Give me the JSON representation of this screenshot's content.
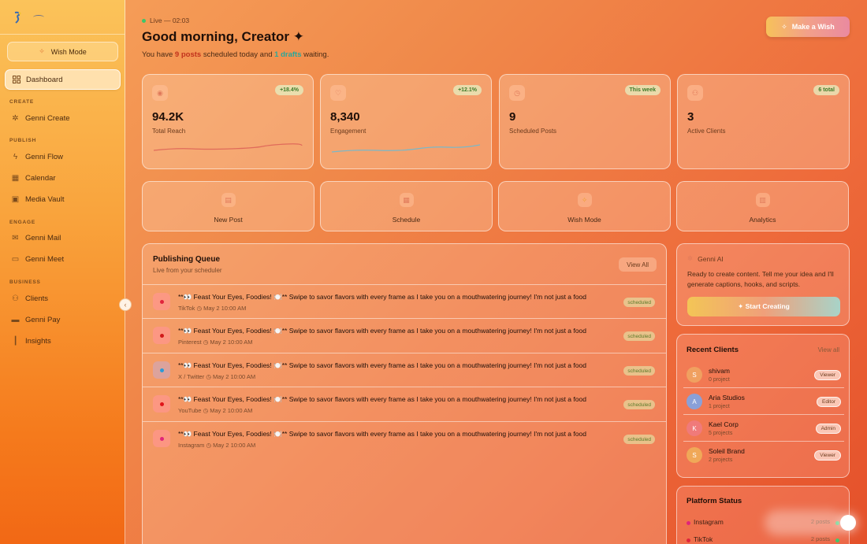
{
  "sidebar": {
    "wish_mode": "Wish Mode",
    "items": [
      {
        "label": "Dashboard",
        "icon": "grid-icon"
      },
      {
        "label": "Genni Create",
        "icon": "sparkles-icon"
      },
      {
        "label": "Genni Flow",
        "icon": "bolt-icon"
      },
      {
        "label": "Calendar",
        "icon": "calendar-icon"
      },
      {
        "label": "Media Vault",
        "icon": "image-icon"
      },
      {
        "label": "Genni Mail",
        "icon": "mail-icon"
      },
      {
        "label": "Genni Meet",
        "icon": "video-icon"
      },
      {
        "label": "Clients",
        "icon": "users-icon"
      },
      {
        "label": "Genni Pay",
        "icon": "card-icon"
      },
      {
        "label": "Insights",
        "icon": "bar-chart-icon"
      }
    ],
    "sections": [
      "CREATE",
      "PUBLISH",
      "ENGAGE",
      "BUSINESS"
    ]
  },
  "header": {
    "live": "Live — 02:03",
    "greeting": "Good morning, Creator",
    "sparkle": "✦",
    "sub_pre": "You have ",
    "sub_posts": "9 posts",
    "sub_mid": " scheduled today and ",
    "sub_drafts": "1 drafts",
    "sub_post": " waiting.",
    "make_wish": "Make a Wish"
  },
  "stats": [
    {
      "value": "94.2K",
      "label": "Total Reach",
      "badge": "+18.4%",
      "icon": "eye-icon"
    },
    {
      "value": "8,340",
      "label": "Engagement",
      "badge": "+12.1%",
      "icon": "heart-icon"
    },
    {
      "value": "9",
      "label": "Scheduled Posts",
      "badge": "This week",
      "icon": "clock-icon"
    },
    {
      "value": "3",
      "label": "Active Clients",
      "badge": "6 total",
      "icon": "users-icon"
    }
  ],
  "quick_actions": [
    {
      "label": "New Post",
      "icon": "file-icon"
    },
    {
      "label": "Schedule",
      "icon": "calendar-icon"
    },
    {
      "label": "Wish Mode",
      "icon": "wand-icon"
    },
    {
      "label": "Analytics",
      "icon": "chart-icon"
    }
  ],
  "queue": {
    "title": "Publishing Queue",
    "subtitle": "Live from your scheduler",
    "view_all": "View All",
    "rows": [
      {
        "text": "**👀 Feast Your Eyes, Foodies! 🍽️** Swipe to savor flavors with every frame as I take you on a mouthwatering journey! I'm not just a food",
        "platform": "TikTok",
        "time": "May 2 10:00 AM",
        "status": "scheduled",
        "dot": "#e0243c"
      },
      {
        "text": "**👀 Feast Your Eyes, Foodies! 🍽️** Swipe to savor flavors with every frame as I take you on a mouthwatering journey! I'm not just a food",
        "platform": "Pinterest",
        "time": "May 2 10:00 AM",
        "status": "scheduled",
        "dot": "#d01a1a"
      },
      {
        "text": "**👀 Feast Your Eyes, Foodies! 🍽️** Swipe to savor flavors with every frame as I take you on a mouthwatering journey! I'm not just a food",
        "platform": "X / Twitter",
        "time": "May 2 10:00 AM",
        "status": "scheduled",
        "dot": "#2a9ad8"
      },
      {
        "text": "**👀 Feast Your Eyes, Foodies! 🍽️** Swipe to savor flavors with every frame as I take you on a mouthwatering journey! I'm not just a food",
        "platform": "YouTube",
        "time": "May 2 10:00 AM",
        "status": "scheduled",
        "dot": "#e0141a"
      },
      {
        "text": "**👀 Feast Your Eyes, Foodies! 🍽️** Swipe to savor flavors with every frame as I take you on a mouthwatering journey! I'm not just a food",
        "platform": "Instagram",
        "time": "May 2 10:00 AM",
        "status": "scheduled",
        "dot": "#e0247a"
      }
    ]
  },
  "ai": {
    "title": "Genni AI",
    "desc": "Ready to create content. Tell me your idea and I'll generate captions, hooks, and scripts.",
    "button": "✦ Start Creating"
  },
  "clients": {
    "title": "Recent Clients",
    "view_all": "View all",
    "rows": [
      {
        "initial": "S",
        "name": "shivam",
        "projects": "0 project",
        "role": "Viewer",
        "color": "#f0a060"
      },
      {
        "initial": "A",
        "name": "Aria Studios",
        "projects": "1 project",
        "role": "Editor",
        "color": "#8aa0d8"
      },
      {
        "initial": "K",
        "name": "Kael Corp",
        "projects": "5 projects",
        "role": "Admin",
        "color": "#f07a7a"
      },
      {
        "initial": "S",
        "name": "Soleil Brand",
        "projects": "2 projects",
        "role": "Viewer",
        "color": "#f0a858"
      }
    ]
  },
  "platforms": {
    "title": "Platform Status",
    "rows": [
      {
        "name": "Instagram",
        "count": "2 posts",
        "color": "#e0247a"
      },
      {
        "name": "TikTok",
        "count": "2 posts",
        "color": "#e0243c"
      }
    ]
  },
  "colors": {
    "accent_red": "#c2321c",
    "accent_teal": "#2aa79a",
    "live_green": "#3fc46a"
  }
}
